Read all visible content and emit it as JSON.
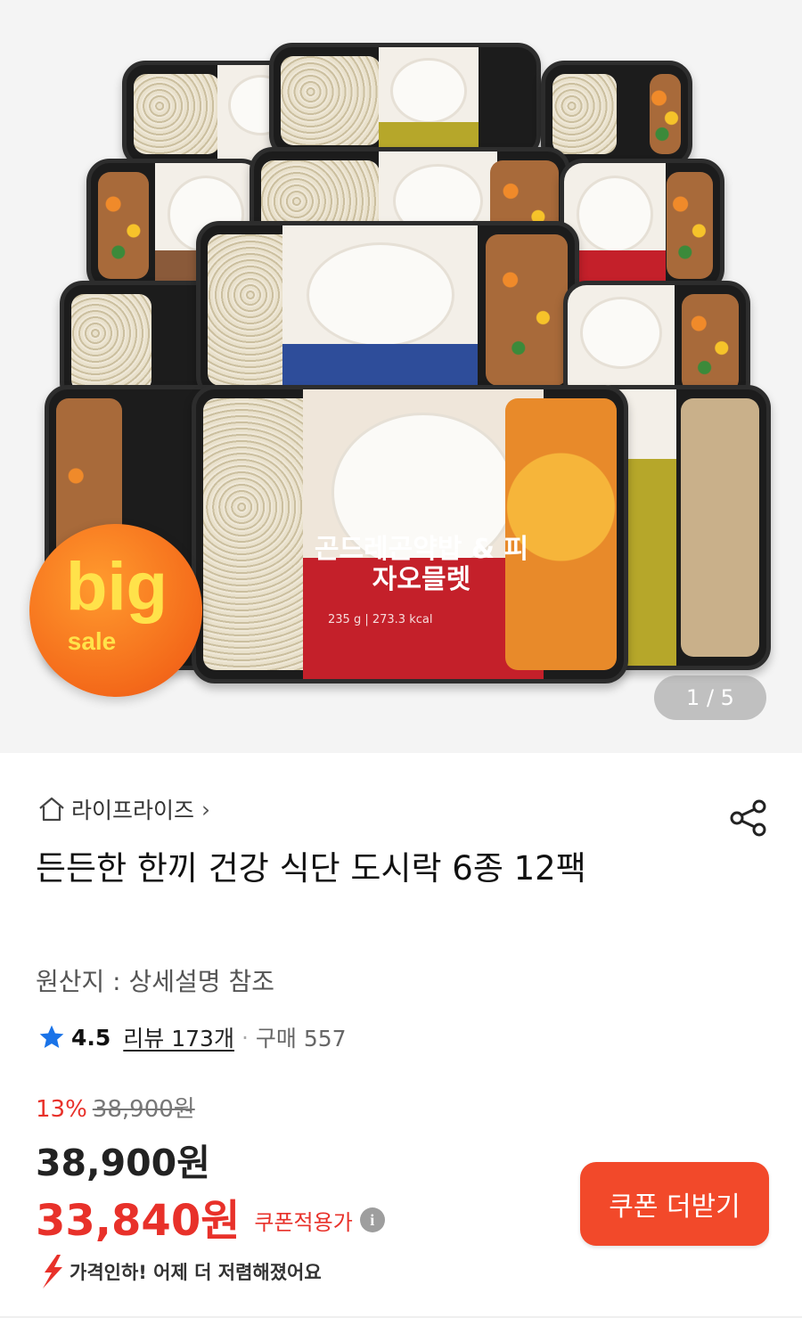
{
  "hero": {
    "badge_big": "big",
    "badge_sale": "sale",
    "main_product_label": "곤드레곤약밥 & 피자오믈렛",
    "main_product_spec": "235 g | 273.3 kcal",
    "pager": "1 / 5"
  },
  "product": {
    "brand": "라이프라이즈",
    "title": "든든한 한끼 건강 식단 도시락 6종 12팩",
    "origin": "원산지 : 상세설명 참조",
    "rating": "4.5",
    "review_link": "리뷰 173개",
    "purchase": "구매 557",
    "discount_pct": "13%",
    "original_price": "38,900원",
    "price": "38,900원",
    "coupon_price": "33,840원",
    "coupon_note": "쿠폰적용가",
    "price_drop_msg": "가격인하! 어제 더 저렴해졌어요"
  },
  "actions": {
    "coupon_button": "쿠폰 더받기"
  },
  "colors": {
    "accent": "#f2492a",
    "discount": "#e8312a",
    "star": "#1a73e8"
  }
}
